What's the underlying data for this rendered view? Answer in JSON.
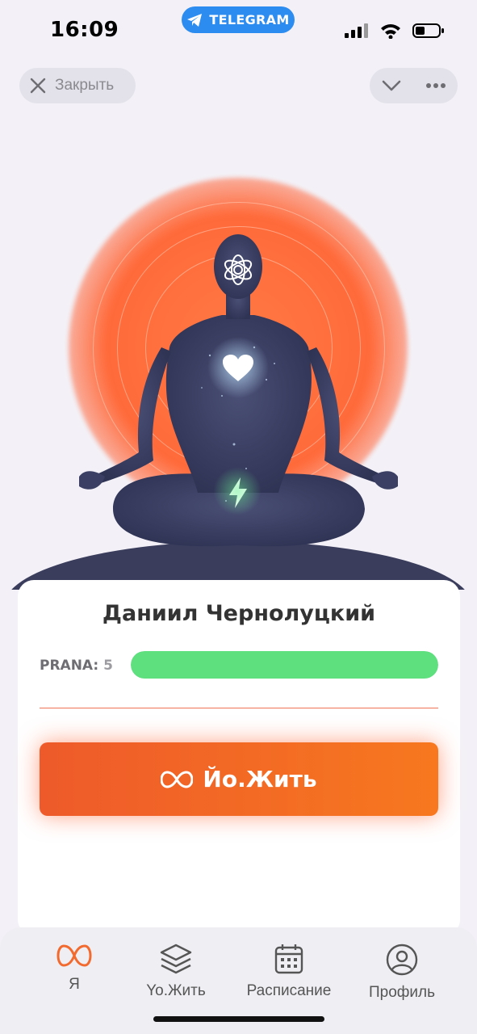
{
  "status_bar": {
    "time": "16:09",
    "telegram_label": "TELEGRAM"
  },
  "top_bar": {
    "close_label": "Закрыть"
  },
  "profile": {
    "name": "Даниил Чернолуцкий",
    "prana_label": "PRANA:",
    "prana_value": "5",
    "prana_fill_fraction": 1.0
  },
  "cta": {
    "label": "Йо.Жить",
    "icon": "infinity-icon"
  },
  "tabs": [
    {
      "label": "Я",
      "icon": "infinity-icon",
      "active": true
    },
    {
      "label": "Yo.Жить",
      "icon": "layers-icon",
      "active": false
    },
    {
      "label": "Расписание",
      "icon": "calendar-icon",
      "active": false
    },
    {
      "label": "Профиль",
      "icon": "user-circle-icon",
      "active": false
    }
  ],
  "colors": {
    "accent": "#f26a2e",
    "progress": "#5fe07f",
    "telegram": "#2d8cf0"
  }
}
